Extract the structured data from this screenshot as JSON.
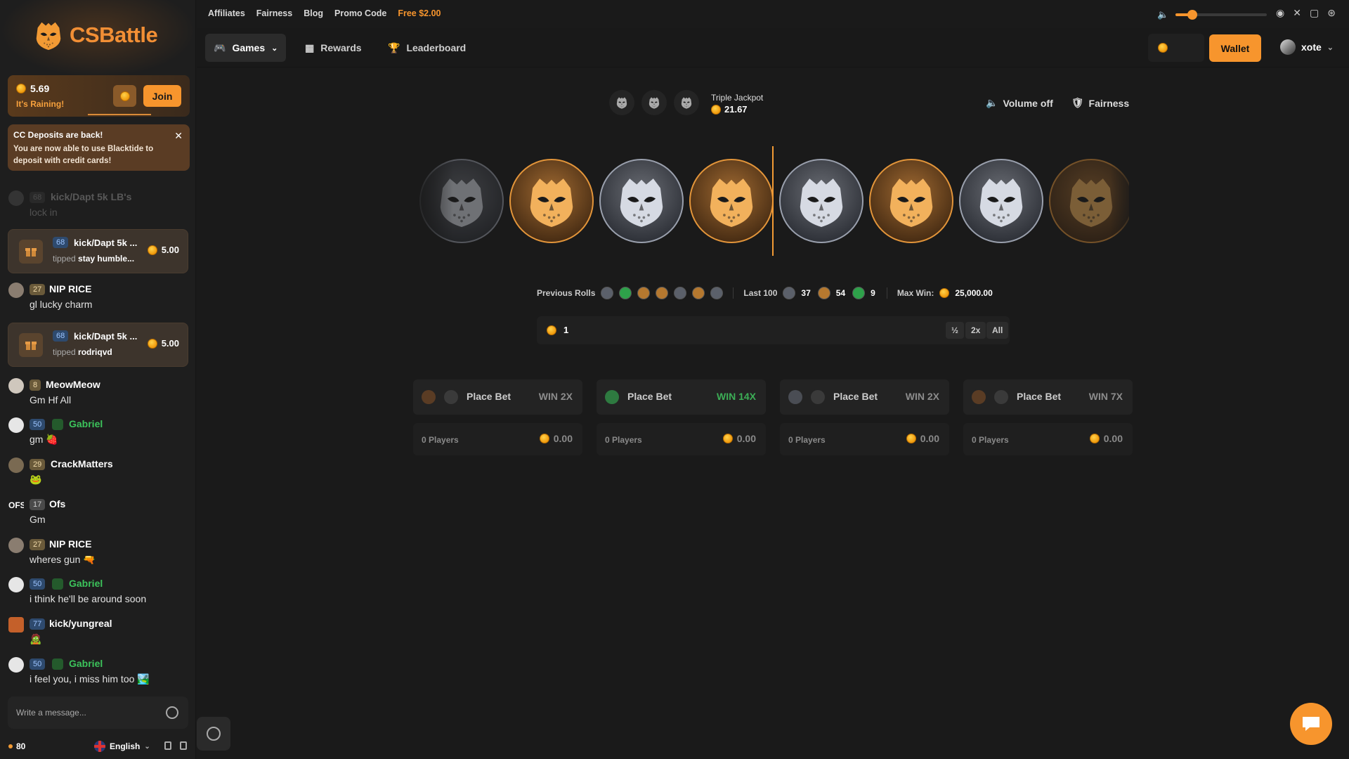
{
  "brand": {
    "name": "CSBattle"
  },
  "rain": {
    "amount": "5.69",
    "status": "It's Raining!",
    "join_label": "Join"
  },
  "notice": {
    "title": "CC Deposits are back!",
    "body": "You are now able to use Blacktide to deposit with credit cards!",
    "close": "✕"
  },
  "chat": {
    "faded": {
      "level": "68",
      "name": "kick/Dapt 5k LB's",
      "text": "lock in"
    },
    "tip1": {
      "level": "68",
      "name": "kick/Dapt 5k ...",
      "tipped": "tipped",
      "to": "stay humble...",
      "amount": "5.00"
    },
    "m1": {
      "level": "27",
      "name": "NIP RICE",
      "text": "gl lucky charm"
    },
    "tip2": {
      "level": "68",
      "name": "kick/Dapt 5k ...",
      "tipped": "tipped",
      "to": "rodriqvd",
      "amount": "5.00"
    },
    "m2": {
      "level": "8",
      "name": "MeowMeow",
      "text": "Gm Hf All"
    },
    "m3": {
      "level": "50",
      "name": "Gabriel",
      "text": "gm 🍓"
    },
    "m4": {
      "level": "29",
      "name": "CrackMatters",
      "text": "🐸"
    },
    "m5": {
      "avatar": "OFS",
      "level": "17",
      "name": "Ofs",
      "text": "Gm"
    },
    "m6": {
      "level": "27",
      "name": "NIP RICE",
      "text": "wheres gun 🔫"
    },
    "m7": {
      "level": "50",
      "name": "Gabriel",
      "text": "i think he'll be around soon"
    },
    "m8": {
      "level": "77",
      "name": "kick/yungreal",
      "text": "🧟"
    },
    "m9": {
      "level": "50",
      "name": "Gabriel",
      "text": "i feel you, i miss him too 🏞️"
    },
    "placeholder": "Write a message..."
  },
  "footer": {
    "online": "80",
    "language": "English"
  },
  "toplinks": [
    "Affiliates",
    "Fairness",
    "Blog",
    "Promo Code"
  ],
  "free_link": "Free $2.00",
  "volume": {
    "level_percent": 18
  },
  "nav": {
    "games": "Games",
    "rewards": "Rewards",
    "leaderboard": "Leaderboard",
    "wallet": "Wallet",
    "username": "xote"
  },
  "game": {
    "jackpot_label": "Triple Jackpot",
    "jackpot_value": "21.67",
    "volume_label": "Volume off",
    "fairness_label": "Fairness",
    "reel": [
      "ct-dim",
      "t",
      "ct",
      "t",
      "ct",
      "t",
      "ct",
      "t-dim"
    ],
    "previous_rolls_label": "Previous Rolls",
    "previous_rolls": [
      "ct",
      "g",
      "t",
      "t",
      "ct",
      "t",
      "ct"
    ],
    "last100_label": "Last 100",
    "last100": {
      "ct": "37",
      "t": "54",
      "bonus": "9"
    },
    "maxwin_label": "Max Win:",
    "maxwin_value": "25,000.00",
    "bet_amount": "1",
    "quick": {
      "half": "½",
      "double": "2x",
      "all": "All"
    },
    "bets": [
      {
        "label": "Place Bet",
        "win": "WIN 2X",
        "players": "0 Players",
        "total": "0.00"
      },
      {
        "label": "Place Bet",
        "win": "WIN 14X",
        "players": "0 Players",
        "total": "0.00"
      },
      {
        "label": "Place Bet",
        "win": "WIN 2X",
        "players": "0 Players",
        "total": "0.00"
      },
      {
        "label": "Place Bet",
        "win": "WIN 7X",
        "players": "0 Players",
        "total": "0.00"
      }
    ]
  },
  "colors": {
    "accent": "#f7952d",
    "ct": "#9aa0ad",
    "t": "#e3953a",
    "bonus": "#2ea14a"
  }
}
